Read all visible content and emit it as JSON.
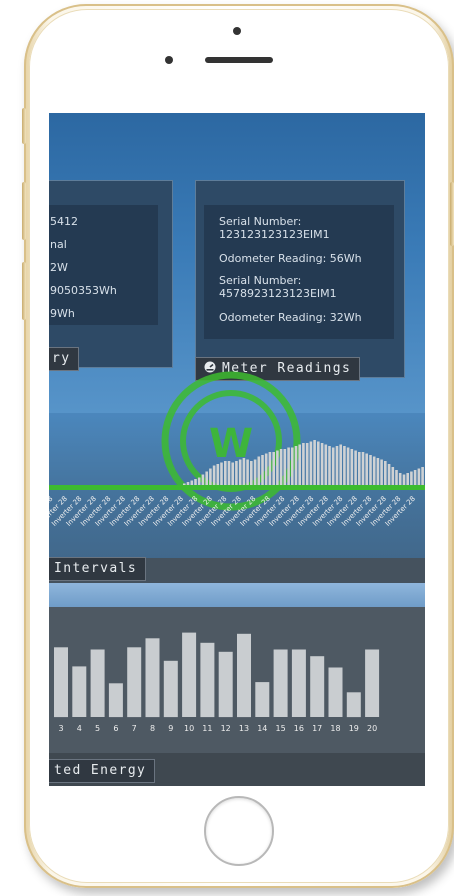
{
  "panels": {
    "left": {
      "lines": [
        "5412",
        "nal",
        "2W",
        "9050353Wh",
        "9Wh"
      ],
      "tag": "ry"
    },
    "meter_readings": {
      "title": "Meter Readings",
      "serial1_label": "Serial Number:",
      "serial1_value": "123123123123EIM1",
      "odometer1": "Odometer Reading: 56Wh",
      "serial2_label": "Serial Number:",
      "serial2_value": "4578923123123EIM1",
      "odometer2": "Odometer Reading: 32Wh"
    }
  },
  "sections": {
    "intervals_tag": "Intervals",
    "energy_tag": "ted Energy"
  },
  "chart_data": [
    {
      "type": "bar",
      "title": "",
      "category_label": "Inverter 28",
      "categories_count": 26,
      "values": [
        0,
        0,
        0,
        0,
        0,
        0,
        0,
        0,
        0,
        0,
        0,
        0,
        0,
        0,
        0,
        0,
        0,
        0,
        0,
        0,
        0,
        0,
        0,
        0,
        0,
        0,
        0,
        0,
        0,
        0,
        0,
        0,
        0,
        0,
        0,
        0,
        1,
        2,
        3,
        4,
        5,
        7,
        9,
        11,
        13,
        14,
        15,
        16,
        16,
        15,
        16,
        17,
        18,
        17,
        16,
        17,
        19,
        20,
        21,
        22,
        22,
        23,
        24,
        24,
        25,
        25,
        26,
        27,
        28,
        28,
        29,
        30,
        29,
        28,
        27,
        26,
        25,
        26,
        27,
        26,
        25,
        24,
        23,
        22,
        22,
        21,
        20,
        19,
        18,
        17,
        16,
        14,
        12,
        10,
        8,
        7,
        8,
        9,
        10,
        11,
        12
      ]
    },
    {
      "type": "bar",
      "title": "",
      "categories": [
        "3",
        "4",
        "5",
        "6",
        "7",
        "8",
        "9",
        "10",
        "11",
        "12",
        "13",
        "14",
        "15",
        "16",
        "17",
        "18",
        "19",
        "20"
      ],
      "values": [
        62,
        45,
        60,
        30,
        62,
        70,
        50,
        75,
        66,
        58,
        74,
        31,
        60,
        60,
        54,
        44,
        22,
        60
      ]
    }
  ],
  "colors": {
    "accent_green": "#3dbb2f",
    "panel_bg": "#2e4a66",
    "tag_bg": "#303841"
  }
}
